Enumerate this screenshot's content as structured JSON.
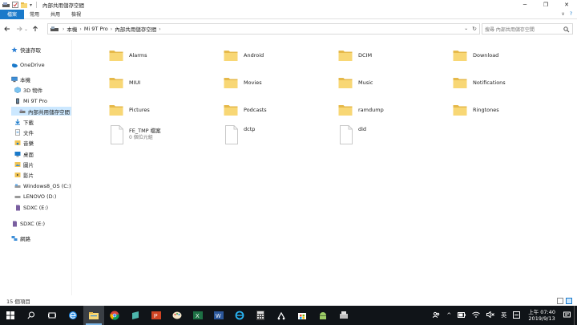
{
  "window": {
    "title": "內部共用儲存空間",
    "minimize": "─",
    "maximize": "❐",
    "close": "✕"
  },
  "ribbon": {
    "tabs": [
      "檔案",
      "常用",
      "共用",
      "檢視"
    ],
    "collapse": "∨",
    "help": "?"
  },
  "address": {
    "crumbs": [
      "本機",
      "Mi 9T Pro",
      "內部共用儲存空間"
    ],
    "search_placeholder": "搜尋 內部共用儲存空間"
  },
  "sidebar": {
    "items": [
      {
        "label": "快速存取",
        "icon": "star-icon"
      },
      {
        "label": "OneDrive",
        "icon": "cloud-icon"
      },
      {
        "label": "本機",
        "icon": "computer-icon"
      },
      {
        "label": "3D 物件",
        "icon": "cube-icon"
      },
      {
        "label": "Mi 9T Pro",
        "icon": "phone-icon"
      },
      {
        "label": "內部共用儲存空間",
        "icon": "storage-icon"
      },
      {
        "label": "下載",
        "icon": "download-icon"
      },
      {
        "label": "文件",
        "icon": "document-icon"
      },
      {
        "label": "音樂",
        "icon": "music-icon"
      },
      {
        "label": "桌面",
        "icon": "desktop-icon"
      },
      {
        "label": "圖片",
        "icon": "pictures-icon"
      },
      {
        "label": "影片",
        "icon": "video-icon"
      },
      {
        "label": "Windows8_OS (C:)",
        "icon": "drive-icon"
      },
      {
        "label": "LENOVO (D:)",
        "icon": "drive-icon"
      },
      {
        "label": "SDXC (E:)",
        "icon": "sdcard-icon"
      },
      {
        "label": "SDXC (E:)",
        "icon": "sdcard-icon"
      },
      {
        "label": "網路",
        "icon": "network-icon"
      }
    ]
  },
  "files": [
    {
      "name": "Alarms",
      "type": "folder"
    },
    {
      "name": "Android",
      "type": "folder"
    },
    {
      "name": "DCIM",
      "type": "folder"
    },
    {
      "name": "Download",
      "type": "folder"
    },
    {
      "name": "MIUI",
      "type": "folder"
    },
    {
      "name": "Movies",
      "type": "folder"
    },
    {
      "name": "Music",
      "type": "folder"
    },
    {
      "name": "Notifications",
      "type": "folder"
    },
    {
      "name": "Pictures",
      "type": "folder"
    },
    {
      "name": "Podcasts",
      "type": "folder"
    },
    {
      "name": "ramdump",
      "type": "folder"
    },
    {
      "name": "Ringtones",
      "type": "folder"
    },
    {
      "name": "FE_TMP 檔案",
      "sub": "0 個位元組",
      "type": "file"
    },
    {
      "name": "dctp",
      "type": "file"
    },
    {
      "name": "did",
      "type": "file"
    }
  ],
  "status": {
    "count": "15 個項目"
  },
  "taskbar": {
    "apps": [
      "windows-start-icon",
      "search-icon",
      "task-view-icon",
      "edge-icon",
      "file-explorer-icon",
      "chrome-icon",
      "app-icon",
      "powerpoint-icon",
      "paint-icon",
      "excel-icon",
      "word-icon",
      "ie-icon",
      "calculator-icon",
      "snipping-icon",
      "store-icon",
      "android-icon",
      "app2-icon"
    ],
    "ime": "英",
    "time": "上午 07:40",
    "date": "2019/9/13"
  },
  "colors": {
    "accent": "#1979ca",
    "folder": "#f8d775",
    "folder_dark": "#e6b94a",
    "selected": "#cce8ff",
    "taskbar": "#101418"
  }
}
